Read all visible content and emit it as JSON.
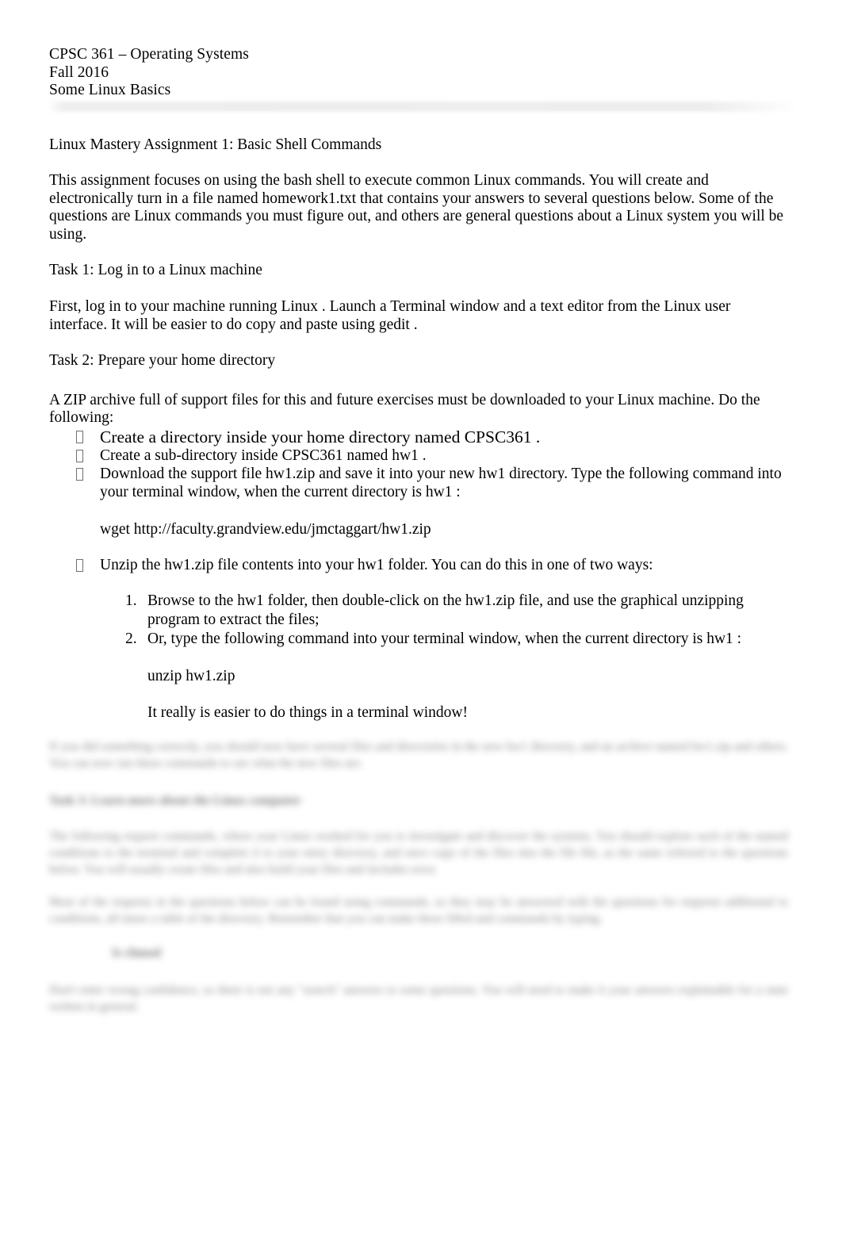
{
  "document": {
    "header": {
      "course": "CPSC 361 – Operating Systems",
      "term": "Fall 2016",
      "subject": "Some Linux Basics"
    },
    "assignment_title": "Linux Mastery Assignment 1: Basic Shell Commands",
    "intro_paragraph": "This assignment focuses on using the bash shell to execute common Linux commands.  You will create and electronically turn in a file named homework1.txt      that contains your answers to several questions below. Some of the questions are Linux commands you must figure out, and others are general questions about a Linux system you will be using.",
    "task1": {
      "heading": "Task 1: Log in to a Linux machine",
      "body": "First, log in to your machine running Linux    . Launch a Terminal   window and a text editor  from the Linux user interface. It will be easier to do copy and paste using gedit    ."
    },
    "task2": {
      "heading": "Task 2: Prepare your home directory",
      "body": "A ZIP archive full of support files for this and future exercises must be downloaded to your Linux machine. Do the following:",
      "bullets": [
        "Create a directory inside your home directory named CPSC361 .",
        "Create a sub-directory inside CPSC361  named hw1 .",
        "Download the support file hw1.zip     and save it into your new hw1 directory.  Type the following command into your terminal window, when the current directory is hw1 :"
      ],
      "wget_command": "wget http://faculty.grandview.edu/jmctaggart/hw1.zip",
      "unzip_bullet": "Unzip the hw1.zip     file contents into your hw1  folder.  You can do this in one of two ways:",
      "numbered": [
        {
          "number": "1.",
          "text": "Browse to the hw1  folder, then double-click on the hw1.zip     file, and use the graphical unzipping program to extract the files;"
        },
        {
          "number": "2.",
          "text": "Or, type the following command into your terminal window, when the current directory is  hw1 :"
        }
      ],
      "unzip_command": "unzip hw1.zip",
      "closing_note": "It really is easier to do things in a terminal window!"
    },
    "redacted": {
      "note": "blurred-illegible",
      "para1": "If you did something correctly, you should now have several files and directories in the new hw1 directory, and an archive named hw1.zip and others. You can now run these commands to see what the new files are.",
      "heading": "Task 3: Learn more about the Linux computer",
      "para2": "The following request commands, where your Linux worked for you to investigate and discover the systems. You should explore each of the named conditions to the terminal and complete it to your entry directory, and once copy of the files into the file file, as the same referred to the questions below. You will usually create files and also build your files and includes error.",
      "para3": "Most of the requests in the questions below can be found using commands, so they may be answered with the questions for requests additional to conditions, all times a table of the directory. Remember that you can make these filled and commands by typing.",
      "indented": "ls  chmod",
      "para4": "Don't enter wrong confidence, so there is not any \"search\" answers to some questions. You will need to make it your answers explainable for a state written in general."
    }
  }
}
